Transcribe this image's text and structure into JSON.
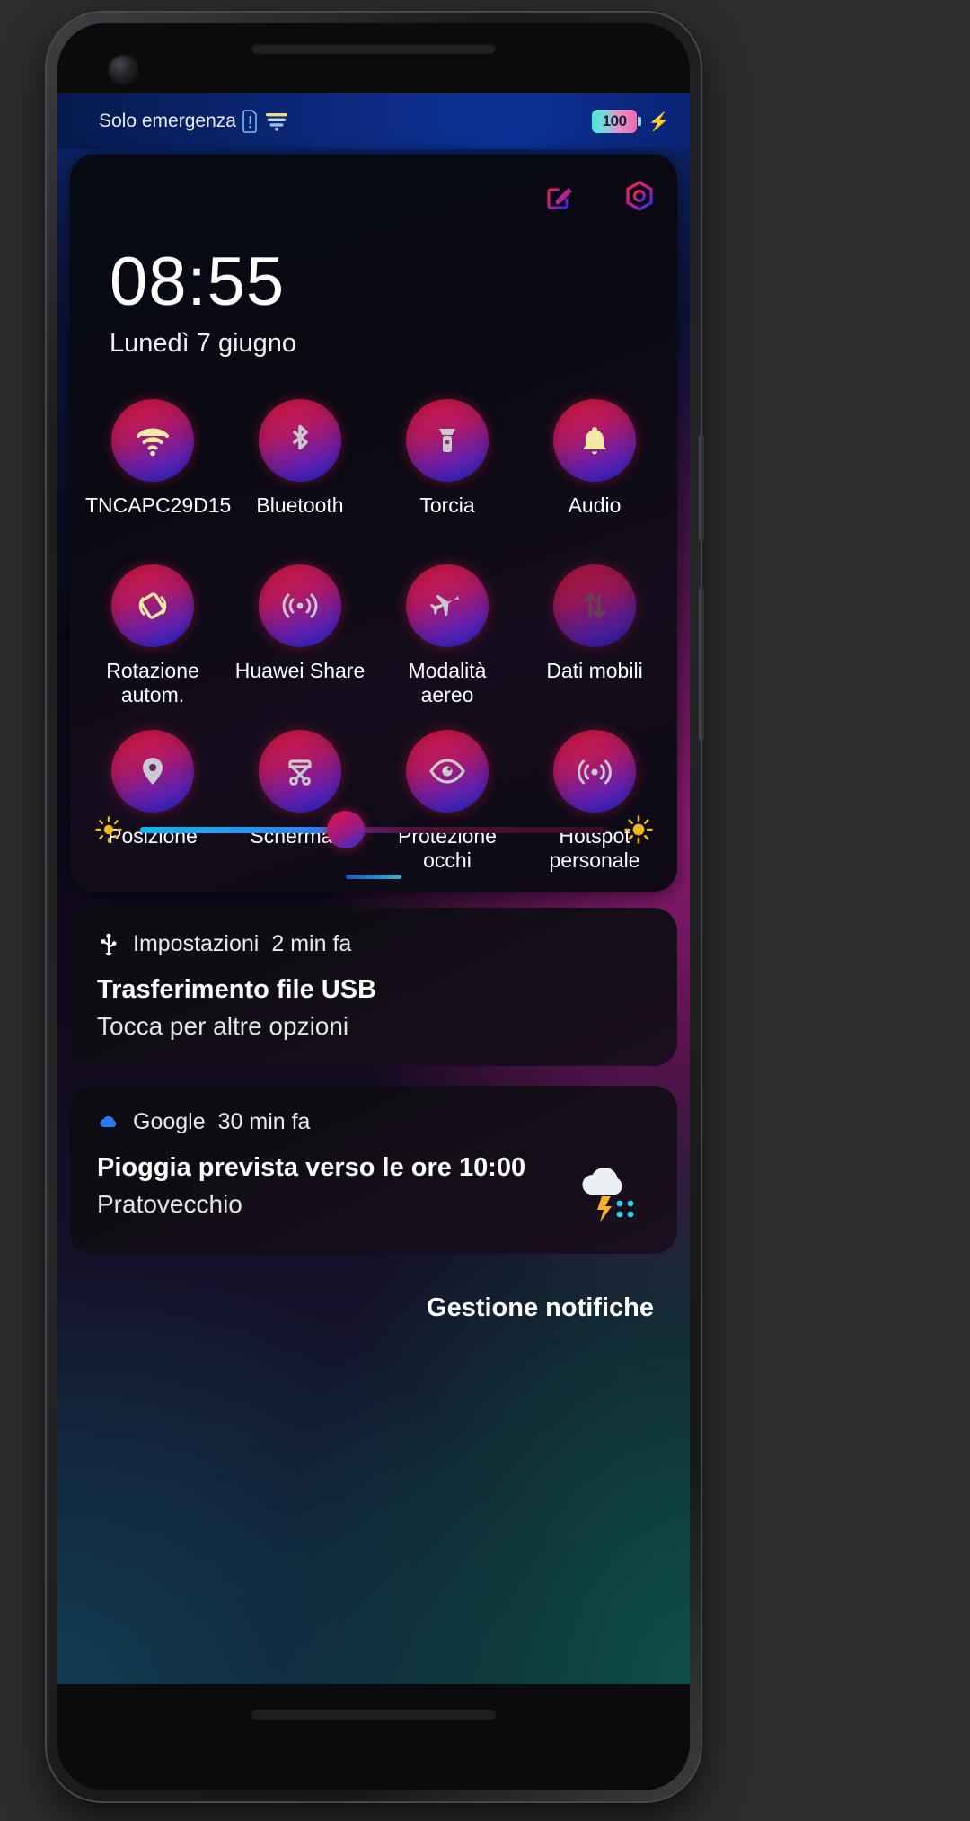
{
  "status_bar": {
    "carrier": "Solo emergenza",
    "sim_icon": "sim-card-icon",
    "signal_icon": "signal-bars-icon",
    "battery_percent": "100",
    "charging_icon": "charging-bolt-icon"
  },
  "quick_settings": {
    "edit_icon": "edit-pencil-icon",
    "settings_icon": "camera-aperture-icon",
    "time": "08:55",
    "date": "Lunedì 7 giugno",
    "toggles": [
      {
        "label": "TNCAPC29D15",
        "icon": "wifi-icon",
        "state": "on"
      },
      {
        "label": "Bluetooth",
        "icon": "bluetooth-icon",
        "state": "off"
      },
      {
        "label": "Torcia",
        "icon": "flashlight-icon",
        "state": "off"
      },
      {
        "label": "Audio",
        "icon": "bell-icon",
        "state": "on"
      },
      {
        "label": "Rotazione autom.",
        "icon": "screen-rotation-icon",
        "state": "on"
      },
      {
        "label": "Huawei Share",
        "icon": "huawei-share-icon",
        "state": "off"
      },
      {
        "label": "Modalità aereo",
        "icon": "airplane-icon",
        "state": "off"
      },
      {
        "label": "Dati mobili",
        "icon": "mobile-data-icon",
        "state": "disabled"
      },
      {
        "label": "Posizione",
        "icon": "location-pin-icon",
        "state": "off"
      },
      {
        "label": "Schermata",
        "icon": "screenshot-scissors-icon",
        "state": "off"
      },
      {
        "label": "Protezione occhi",
        "icon": "eye-icon",
        "state": "off"
      },
      {
        "label": "Hotspot personale",
        "icon": "hotspot-icon",
        "state": "off"
      }
    ],
    "brightness": {
      "low_icon": "brightness-low-icon",
      "high_icon": "brightness-high-icon",
      "value_percent": 44
    },
    "handle": "panel-drag-handle"
  },
  "notifications": [
    {
      "app_icon": "usb-icon",
      "app": "Impostazioni",
      "time": "2 min fa",
      "title": "Trasferimento file USB",
      "body": "Tocca per altre opzioni",
      "thumb": null
    },
    {
      "app_icon": "google-cloud-icon",
      "app": "Google",
      "time": "30 min fa",
      "title": "Pioggia prevista verso le ore 10:00",
      "body": "Pratovecchio",
      "thumb": "rain-thunder-icon"
    }
  ],
  "manage_notifications_label": "Gestione notifiche",
  "colors": {
    "toggle_gradient_start": "#d9183c",
    "toggle_gradient_end": "#1c27d8",
    "notification_border_start": "#ff1f3d",
    "notification_border_end": "#1b2fe0",
    "active_icon": "#f5e9a6",
    "inactive_icon": "#c9c9cf",
    "status_bar_bg": "#0b2a80"
  }
}
